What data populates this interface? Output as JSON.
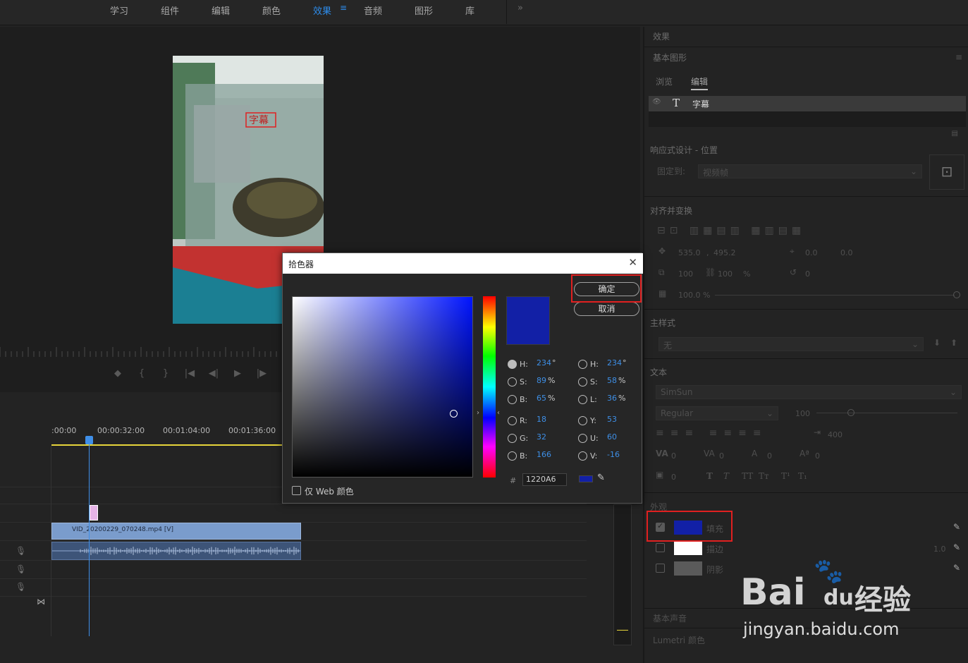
{
  "workspaces": {
    "tabs": [
      {
        "label": "学习"
      },
      {
        "label": "组件"
      },
      {
        "label": "编辑"
      },
      {
        "label": "颜色"
      },
      {
        "label": "效果",
        "active": true
      },
      {
        "label": "音频"
      },
      {
        "label": "图形"
      },
      {
        "label": "库"
      }
    ],
    "menu_icon": "hamburger-icon",
    "more_icon": "chevron-double-right-icon"
  },
  "program": {
    "video_overlay_text": "字幕",
    "transport_icons": [
      "marker-icon",
      "in-point-icon",
      "out-point-icon",
      "go-to-in-icon",
      "step-back-icon",
      "play-icon",
      "step-forward-icon"
    ]
  },
  "timeline": {
    "timecodes": [
      ":00:00",
      "00:00:32:00",
      "00:01:04:00",
      "00:01:36:00"
    ],
    "video_clip": "VID_20200229_070248.mp4 [V]"
  },
  "effects_panel": {
    "panel_title": "效果",
    "section_title": "基本图形",
    "tabs": {
      "browse": "浏览",
      "edit": "编辑"
    },
    "layer": {
      "icon": "T",
      "name": "字幕"
    },
    "responsive": {
      "heading": "响应式设计 - 位置",
      "pin_label": "固定到:",
      "pin_value": "视频帧"
    },
    "align": {
      "heading": "对齐并变换",
      "pos_x": "535.0",
      "pos_sep": ",",
      "pos_y": "495.2",
      "anchor_x": "0.0",
      "anchor_y": "0.0",
      "scale_w": "100",
      "scale_h": "100",
      "scale_unit": "%",
      "rotation": "0",
      "opacity": "100.0 %"
    },
    "master_style": {
      "heading": "主样式",
      "value": "无"
    },
    "text": {
      "heading": "文本",
      "font": "SimSun",
      "style": "Regular",
      "size": "100",
      "tab_width": "400",
      "kerning": "0",
      "tracking": "0",
      "leading": "0",
      "baseline": "0",
      "tsume": "0",
      "styles": [
        "T",
        "T",
        "TT",
        "Tт",
        "T¹",
        "T₁"
      ]
    },
    "appearance": {
      "heading": "外观",
      "fill": {
        "label": "填充",
        "color": "#1220A6",
        "checked": true
      },
      "stroke": {
        "label": "描边",
        "color": "#FFFFFF",
        "checked": false,
        "width": "1.0"
      },
      "shadow": {
        "label": "阴影",
        "color": "#5a5a5a",
        "checked": false
      }
    },
    "essential_sound": "基本声音",
    "lumetri": "Lumetri 颜色"
  },
  "color_picker": {
    "title": "拾色器",
    "ok": "确定",
    "cancel": "取消",
    "hsb": {
      "h_label": "H:",
      "h": "234",
      "h_unit": "°",
      "s_label": "S:",
      "s": "89",
      "s_unit": "%",
      "b_label": "B:",
      "b": "65",
      "b_unit": "%"
    },
    "rgb": {
      "r_label": "R:",
      "r": "18",
      "g_label": "G:",
      "g": "32",
      "b_label": "B:",
      "b": "166"
    },
    "hsl": {
      "h_label": "H:",
      "h": "234",
      "h_unit": "°",
      "s_label": "S:",
      "s": "58",
      "s_unit": "%",
      "l_label": "L:",
      "l": "36",
      "l_unit": "%"
    },
    "yuv": {
      "y_label": "Y:",
      "y": "53",
      "u_label": "U:",
      "u": "60",
      "v_label": "V:",
      "v": "-16"
    },
    "hash": "#",
    "hex": "1220A6",
    "web_only": "仅 Web 颜色",
    "color": "#1220A6"
  },
  "watermark": {
    "brand": "Bai",
    "brand_du": "du",
    "brand_cn": "经验",
    "url": "jingyan.baidu.com"
  }
}
